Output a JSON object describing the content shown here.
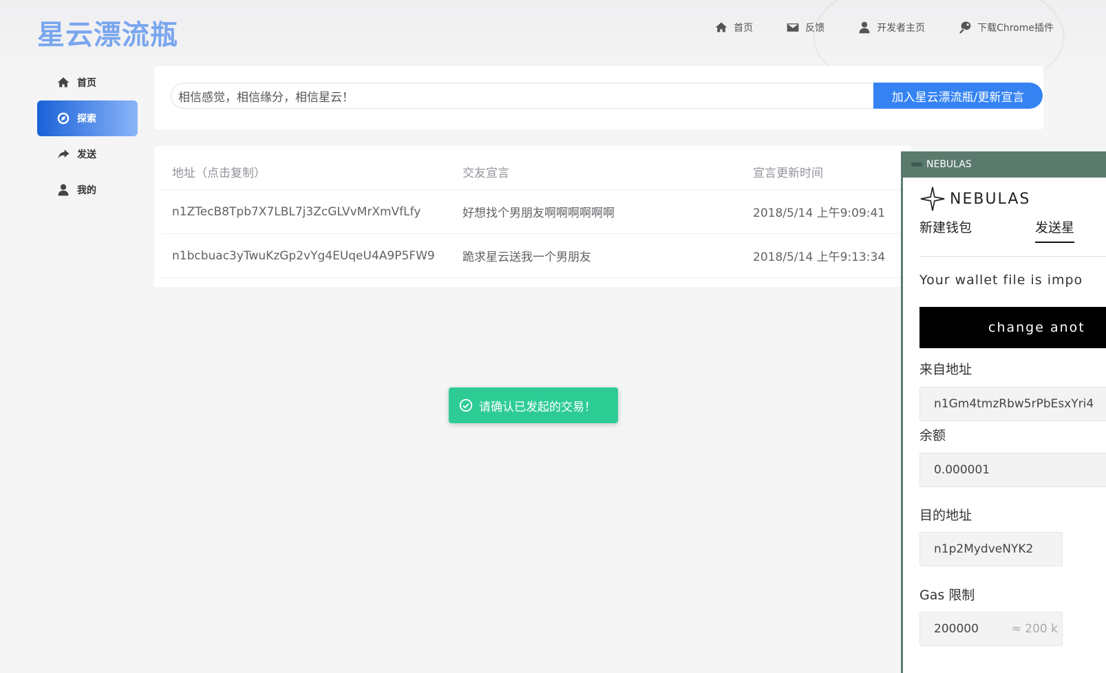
{
  "app": {
    "logo": "星云漂流瓶"
  },
  "topnav": [
    {
      "label": "首页",
      "icon": "home-icon"
    },
    {
      "label": "反馈",
      "icon": "mail-icon"
    },
    {
      "label": "开发者主页",
      "icon": "user-icon"
    },
    {
      "label": "下载Chrome插件",
      "icon": "key-icon"
    }
  ],
  "sidebar": [
    {
      "label": "首页",
      "icon": "home-icon",
      "active": false
    },
    {
      "label": "探索",
      "icon": "compass-icon",
      "active": true
    },
    {
      "label": "发送",
      "icon": "share-icon",
      "active": false
    },
    {
      "label": "我的",
      "icon": "user-icon",
      "active": false
    }
  ],
  "search": {
    "value": "相信感觉，相信缘分，相信星云！",
    "button_label": "加入星云漂流瓶/更新宣言"
  },
  "table": {
    "headers": [
      "地址（点击复制）",
      "交友宣言",
      "宣言更新时间"
    ],
    "rows": [
      [
        "n1ZTecB8Tpb7X7LBL7j3ZcGLVvMrXmVfLfy",
        "好想找个男朋友啊啊啊啊啊啊",
        "2018/5/14 上午9:09:41"
      ],
      [
        "n1bcbuac3yTwuKzGp2vYg4EUqeU4A9P5FW9",
        "跪求星云送我一个男朋友",
        "2018/5/14 上午9:13:34"
      ]
    ]
  },
  "toast": {
    "text": "请确认已发起的交易！",
    "icon": "check-circle-icon"
  },
  "wallet": {
    "titlebar": "NEBULAS",
    "brand": "NEBULAS",
    "tabs": [
      "新建钱包",
      "发送星"
    ],
    "note": "Your wallet file is impo",
    "change_button": "change anot",
    "from_label": "来自地址",
    "from_value": "n1Gm4tmzRbw5rPbEsxYri4",
    "balance_label": "余额",
    "balance_value": "0.000001",
    "to_label": "目的地址",
    "to_value": "n1p2MydveNYK2",
    "gas_label": "Gas 限制",
    "gas_value": "200000",
    "gas_suffix": "≈ 200 k"
  }
}
